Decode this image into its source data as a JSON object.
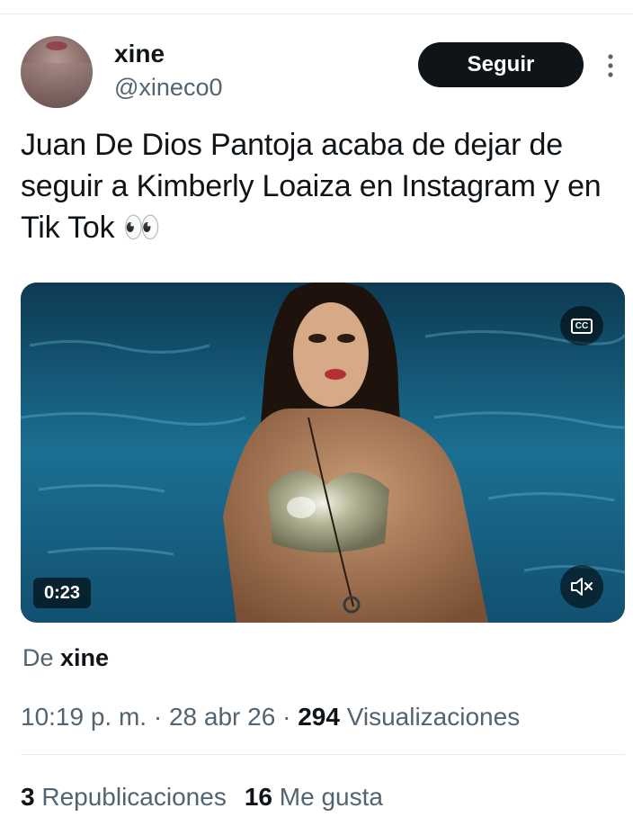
{
  "user": {
    "name": "xine",
    "handle": "@xineco0"
  },
  "follow_button": {
    "label": "Seguir"
  },
  "tweet": {
    "text": "Juan De Dios Pantoja acaba de dejar de seguir a Kimberly Loaiza en Instagram y en Tik Tok 👀"
  },
  "video": {
    "duration": "0:23",
    "cc_label": "CC",
    "icons": [
      "closed-captions-icon",
      "mute-icon"
    ]
  },
  "source": {
    "prefix": "De",
    "author": "xine"
  },
  "meta": {
    "time": "10:19 p. m.",
    "separator": "·",
    "date": "28 abr 26",
    "views_count": "294",
    "views_label": "Visualizaciones"
  },
  "stats": {
    "reposts_count": "3",
    "reposts_label": "Republicaciones",
    "likes_count": "16",
    "likes_label": "Me gusta"
  },
  "colors": {
    "text_primary": "#0f1419",
    "text_secondary": "#536471",
    "button_bg": "#0f1419",
    "divider": "#e6ecf0"
  }
}
